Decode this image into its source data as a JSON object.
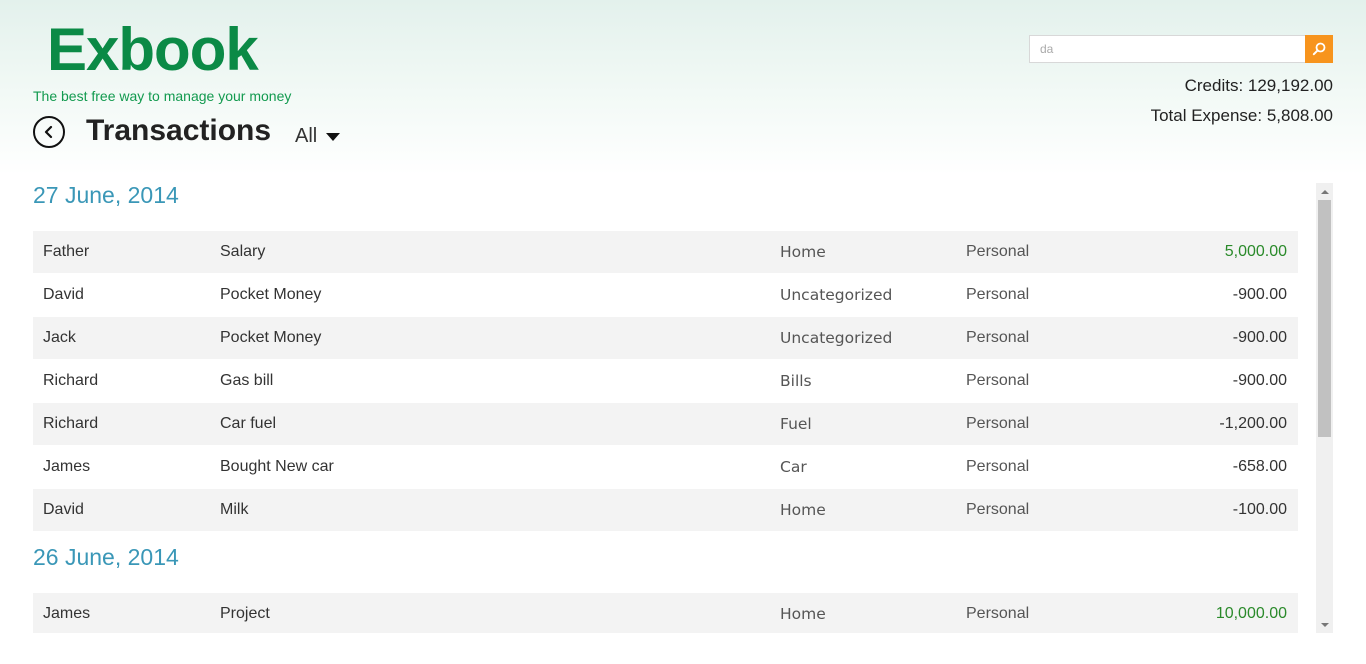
{
  "app": {
    "logo": "Exbook",
    "tagline": "The best free way to manage your money"
  },
  "header": {
    "title": "Transactions",
    "filter_label": "All",
    "search_value": "da",
    "credits": "Credits: 129,192.00",
    "total_expense": "Total Expense: 5,808.00"
  },
  "colors": {
    "brand": "#0b8a46",
    "date_heading": "#3a97b7",
    "positive": "#2a8a2a",
    "search_button": "#f7941d"
  },
  "groups": [
    {
      "date": "27 June, 2014",
      "rows": [
        {
          "name": "Father",
          "description": "Salary",
          "category": "Home",
          "type": "Personal",
          "amount": "5,000.00",
          "positive": true
        },
        {
          "name": "David",
          "description": "Pocket Money",
          "category": "Uncategorized",
          "type": "Personal",
          "amount": "-900.00",
          "positive": false
        },
        {
          "name": "Jack",
          "description": "Pocket Money",
          "category": "Uncategorized",
          "type": "Personal",
          "amount": "-900.00",
          "positive": false
        },
        {
          "name": "Richard",
          "description": "Gas bill",
          "category": "Bills",
          "type": "Personal",
          "amount": "-900.00",
          "positive": false
        },
        {
          "name": "Richard",
          "description": "Car fuel",
          "category": "Fuel",
          "type": "Personal",
          "amount": "-1,200.00",
          "positive": false
        },
        {
          "name": "James",
          "description": "Bought New car",
          "category": "Car",
          "type": "Personal",
          "amount": "-658.00",
          "positive": false
        },
        {
          "name": "David",
          "description": "Milk",
          "category": "Home",
          "type": "Personal",
          "amount": "-100.00",
          "positive": false
        }
      ]
    },
    {
      "date": "26 June, 2014",
      "rows": [
        {
          "name": "James",
          "description": "Project",
          "category": "Home",
          "type": "Personal",
          "amount": "10,000.00",
          "positive": true
        }
      ]
    }
  ],
  "icons": {
    "back": "chevron-left-icon",
    "search": "search-icon",
    "filter": "caret-down-icon"
  }
}
